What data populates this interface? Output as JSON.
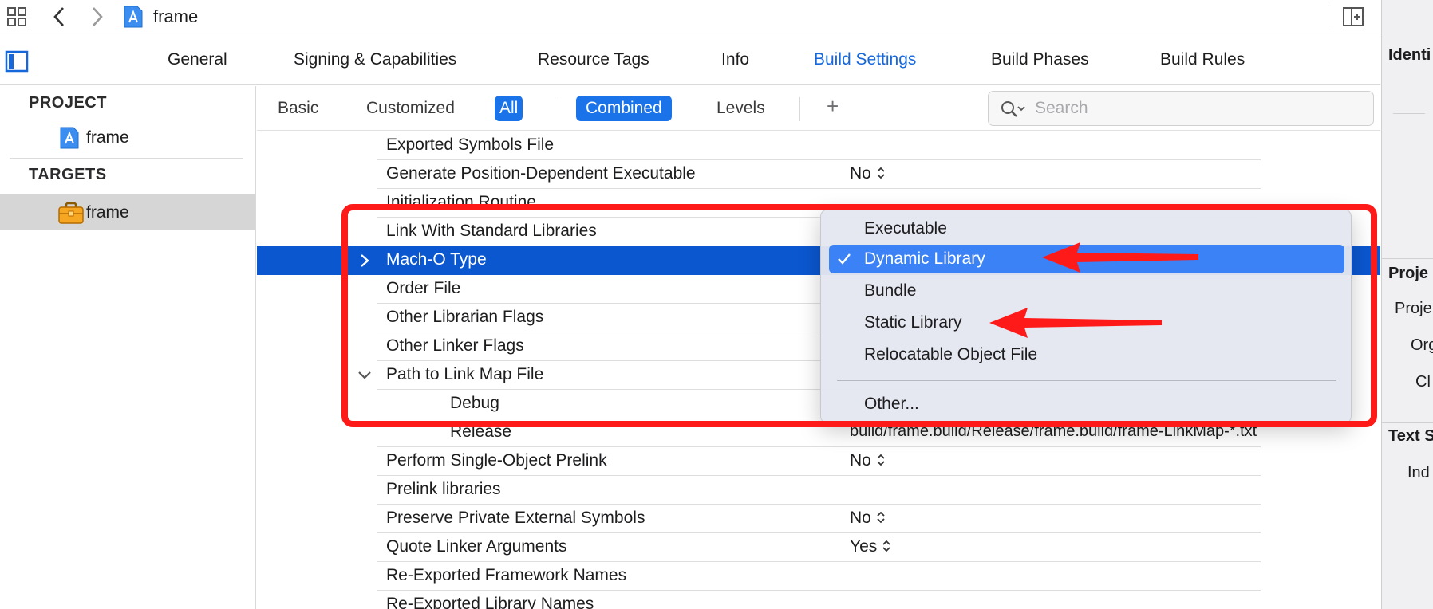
{
  "toolbar": {
    "title": "frame",
    "icons": [
      "grid-icon",
      "back-arrow-icon",
      "forward-arrow-icon",
      "app-project-icon",
      "add-editor-icon"
    ]
  },
  "tabs": [
    {
      "label": "General",
      "active": false
    },
    {
      "label": "Signing & Capabilities",
      "active": false
    },
    {
      "label": "Resource Tags",
      "active": false
    },
    {
      "label": "Info",
      "active": false
    },
    {
      "label": "Build Settings",
      "active": true
    },
    {
      "label": "Build Phases",
      "active": false
    },
    {
      "label": "Build Rules",
      "active": false
    }
  ],
  "navigator": {
    "project_header": "PROJECT",
    "project_item": "frame",
    "targets_header": "TARGETS",
    "target_item": "frame"
  },
  "filter": {
    "basic": "Basic",
    "customized": "Customized",
    "all": "All",
    "combined": "Combined",
    "levels": "Levels",
    "plus": "+",
    "search_placeholder": "Search",
    "search_value": ""
  },
  "settings": [
    {
      "name": "Exported Symbols File",
      "value": ""
    },
    {
      "name": "Generate Position-Dependent Executable",
      "value": "No"
    },
    {
      "name": "Initialization Routine",
      "value": ""
    },
    {
      "name": "Link With Standard Libraries",
      "value": ""
    },
    {
      "name": "Mach-O Type",
      "value": ""
    },
    {
      "name": "Order File",
      "value": ""
    },
    {
      "name": "Other Librarian Flags",
      "value": ""
    },
    {
      "name": "Other Linker Flags",
      "value": ""
    },
    {
      "name": "Path to Link Map File",
      "value": ""
    },
    {
      "name": "Debug",
      "value": ""
    },
    {
      "name": "Release",
      "value": "build/frame.build/Release/frame.build/frame-LinkMap-*.txt"
    },
    {
      "name": "Perform Single-Object Prelink",
      "value": "No"
    },
    {
      "name": "Prelink libraries",
      "value": ""
    },
    {
      "name": "Preserve Private External Symbols",
      "value": "No"
    },
    {
      "name": "Quote Linker Arguments",
      "value": "Yes"
    },
    {
      "name": "Re-Exported Framework Names",
      "value": ""
    },
    {
      "name": "Re-Exported Library Names",
      "value": ""
    }
  ],
  "menu": {
    "items": [
      {
        "label": "Executable",
        "checked": false
      },
      {
        "label": "Dynamic Library",
        "checked": true
      },
      {
        "label": "Bundle",
        "checked": false
      },
      {
        "label": "Static Library",
        "checked": false
      },
      {
        "label": "Relocatable Object File",
        "checked": false
      },
      {
        "label": "Other...",
        "checked": false
      }
    ]
  },
  "inspector": {
    "identity": "Identi",
    "project_doc": "Proje",
    "project_label": "Proje",
    "org_label": "Org",
    "class_label": "Cl",
    "text_settings": "Text S",
    "indent_label": "Ind"
  },
  "colors": {
    "accent": "#1667d9",
    "selection": "#0b57d0",
    "pill": "#1a73e8",
    "menu_highlight": "#3b82f6",
    "annotation": "#ff1a1a"
  }
}
